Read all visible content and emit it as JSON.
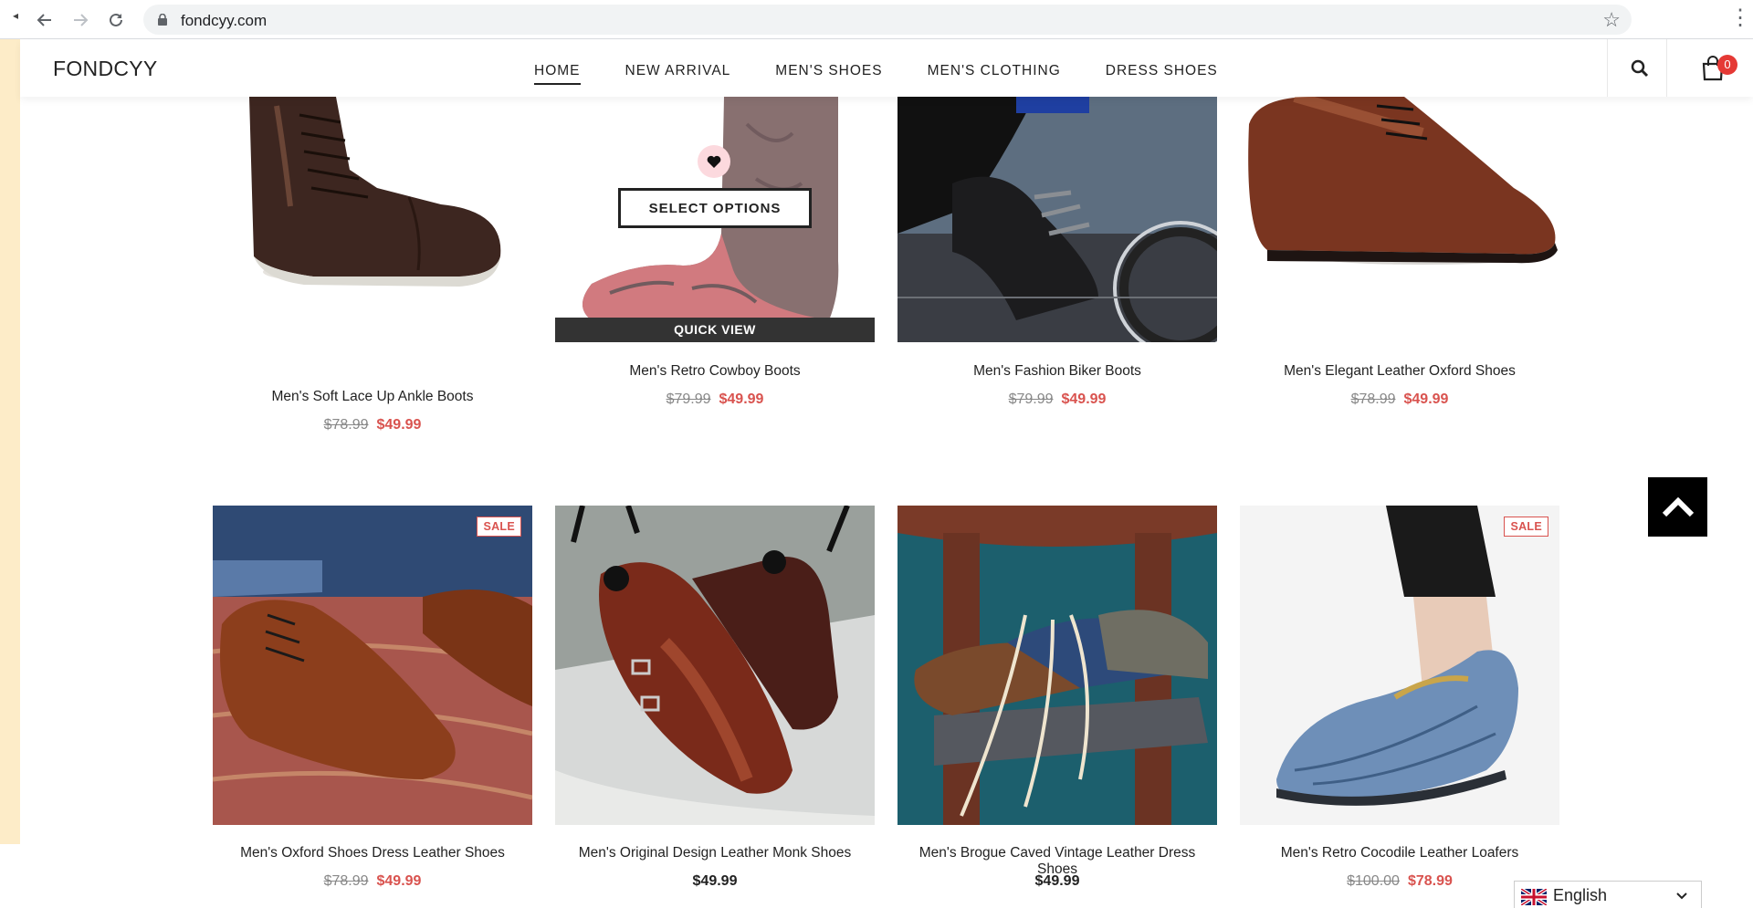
{
  "browser": {
    "url": "fondcyy.com"
  },
  "site": {
    "logo": "FONDCYY",
    "nav": [
      "HOME",
      "NEW ARRIVAL",
      "MEN'S SHOES",
      "MEN'S CLOTHING",
      "DRESS SHOES"
    ],
    "cart_count": "0"
  },
  "products_row1": [
    {
      "name": "Men's Soft Lace Up Ankle Boots",
      "old_price": "$78.99",
      "price": "$49.99"
    },
    {
      "name": "Men's Retro Cowboy Boots",
      "old_price": "$79.99",
      "price": "$49.99",
      "select_options": "SELECT OPTIONS",
      "quick_view": "QUICK VIEW"
    },
    {
      "name": "Men's Fashion Biker Boots",
      "old_price": "$79.99",
      "price": "$49.99"
    },
    {
      "name": "Men's Elegant Leather Oxford Shoes",
      "old_price": "$78.99",
      "price": "$49.99"
    }
  ],
  "products_row2": [
    {
      "name": "Men's Oxford Shoes Dress Leather Shoes",
      "old_price": "$78.99",
      "price": "$49.99",
      "badge": "SALE"
    },
    {
      "name": "Men's Original Design Leather Monk Shoes",
      "price": "$49.99"
    },
    {
      "name": "Men's Brogue Caved Vintage Leather Dress Shoes",
      "price": "$49.99"
    },
    {
      "name": "Men's Retro Cocodile Leather Loafers",
      "old_price": "$100.00",
      "price": "$78.99",
      "badge": "SALE"
    }
  ],
  "language": "English",
  "colors": {
    "sale_red": "#d9534f",
    "cart_badge": "#e53935",
    "side_strip": "#fdecc8"
  }
}
